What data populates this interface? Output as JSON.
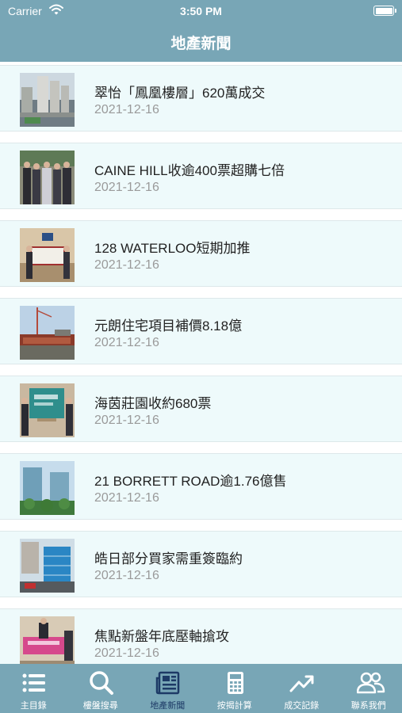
{
  "status_bar": {
    "carrier": "Carrier",
    "time": "3:50 PM"
  },
  "nav": {
    "title": "地產新聞"
  },
  "news": [
    {
      "title": "翠怡「鳳凰樓層」620萬成交",
      "date": "2021-12-16"
    },
    {
      "title": "CAINE HILL收逾400票超購七倍",
      "date": "2021-12-16"
    },
    {
      "title": "128 WATERLOO短期加推",
      "date": "2021-12-16"
    },
    {
      "title": "元朗住宅項目補價8.18億",
      "date": "2021-12-16"
    },
    {
      "title": "海茵莊園收約680票",
      "date": "2021-12-16"
    },
    {
      "title": "21 BORRETT ROAD逾1.76億售",
      "date": "2021-12-16"
    },
    {
      "title": "皓日部分買家需重簽臨約",
      "date": "2021-12-16"
    },
    {
      "title": "焦點新盤年底壓軸搶攻",
      "date": "2021-12-16"
    }
  ],
  "tabs": [
    {
      "label": "主目錄",
      "icon": "list-icon"
    },
    {
      "label": "樓盤搜尋",
      "icon": "search-icon"
    },
    {
      "label": "地產新聞",
      "icon": "newspaper-icon",
      "active": true
    },
    {
      "label": "按揭計算",
      "icon": "calculator-icon"
    },
    {
      "label": "成交記錄",
      "icon": "trend-up-icon"
    },
    {
      "label": "聯系我們",
      "icon": "users-icon"
    }
  ],
  "colors": {
    "bar": "#78a6b6",
    "row_bg": "#eefafb",
    "active_tab": "#1d3a66"
  }
}
